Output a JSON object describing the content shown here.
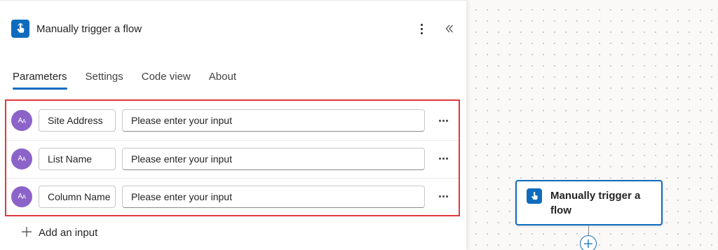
{
  "panel": {
    "title": "Manually trigger a flow",
    "icon": "touch-trigger-icon",
    "tabs": [
      {
        "label": "Parameters",
        "active": true
      },
      {
        "label": "Settings",
        "active": false
      },
      {
        "label": "Code view",
        "active": false
      },
      {
        "label": "About",
        "active": false
      }
    ],
    "inputs": [
      {
        "avatar": "text-type-icon",
        "name": "Site Address",
        "placeholder": "Please enter your input"
      },
      {
        "avatar": "text-type-icon",
        "name": "List Name",
        "placeholder": "Please enter your input"
      },
      {
        "avatar": "text-type-icon",
        "name": "Column Name",
        "placeholder": "Please enter your input"
      }
    ],
    "add_input_label": "Add an input"
  },
  "canvas": {
    "card_label": "Manually trigger a flow",
    "add_step_icon": "plus-circle-icon"
  },
  "colors": {
    "accent": "#0f6cbd",
    "avatar": "#8c63c9",
    "highlight_border": "#e0393e"
  }
}
